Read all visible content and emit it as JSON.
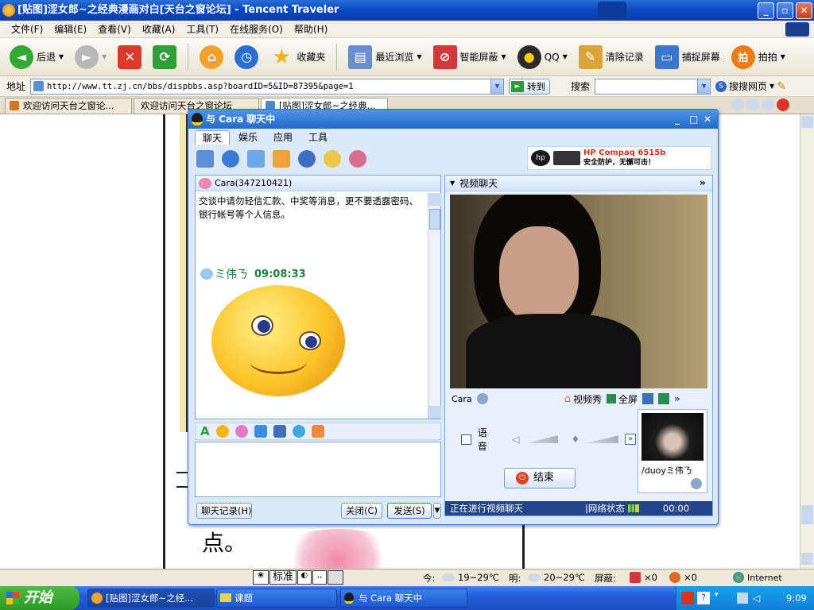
{
  "browser": {
    "title": "[贴图]涩女郎~之经典漫画对白[天台之窗论坛] - Tencent Traveler",
    "menu": [
      "文件(F)",
      "编辑(E)",
      "查看(V)",
      "收藏(A)",
      "工具(T)",
      "在线服务(O)",
      "帮助(H)"
    ],
    "toolbar": {
      "back": "后退",
      "favorites": "收藏夹",
      "recent": "最近浏览",
      "block": "智能屏蔽",
      "qq": "QQ",
      "clear": "清除记录",
      "capture": "捕捉屏幕",
      "photo": "拍拍"
    },
    "address_label": "地址",
    "address_value": "http://www.tt.zj.cn/bbs/dispbbs.asp?boardID=5&ID=87395&page=1",
    "go_label": "转到",
    "search_label": "搜索",
    "search_engine": "搜搜网页",
    "tabs": [
      "欢迎访问天台之窗论...",
      "欢迎访问天台之窗论坛",
      "[贴图]涩女郎~之经典..."
    ]
  },
  "page_text": "点。",
  "chat": {
    "title": "与 Cara 聊天中",
    "tabs": [
      "聊天",
      "娱乐",
      "应用",
      "工具"
    ],
    "ad_text": "HP Compaq 6515b",
    "ad_slogan": "安全防护，无懈可击！",
    "contact_header": "Cara(347210421)",
    "warning": "交谈中请勿轻信汇款、中奖等消息，更不要透露密码、银行帐号等个人信息。",
    "sender": "ミ伟ㄋ",
    "time": "09:08:33",
    "video_header": "视频聊天",
    "video_name": "Cara",
    "video_show": "视频秀",
    "fullscreen": "全屏",
    "voice": "语音",
    "end_call": "结束",
    "self_name": "/duoyミ伟ㄋ",
    "history_btn": "聊天记录(H)",
    "close_btn": "关闭(C)",
    "send_btn": "发送(S)",
    "status_video": "正在进行视频聊天",
    "network": "|网络状态",
    "timer": "00:00"
  },
  "status_bar": {
    "today": "今:",
    "today_temp": "19~29℃",
    "tomorrow": "明:",
    "tomorrow_temp": "20~29℃",
    "block_label": "屏蔽:",
    "count1": "×0",
    "count2": "×0",
    "zone": "Internet"
  },
  "ime": {
    "mode": "标准"
  },
  "taskbar": {
    "start": "开始",
    "tasks": [
      "[贴图]涩女郎~之经...",
      "课题",
      "与 Cara 聊天中"
    ],
    "clock": "9:09"
  }
}
